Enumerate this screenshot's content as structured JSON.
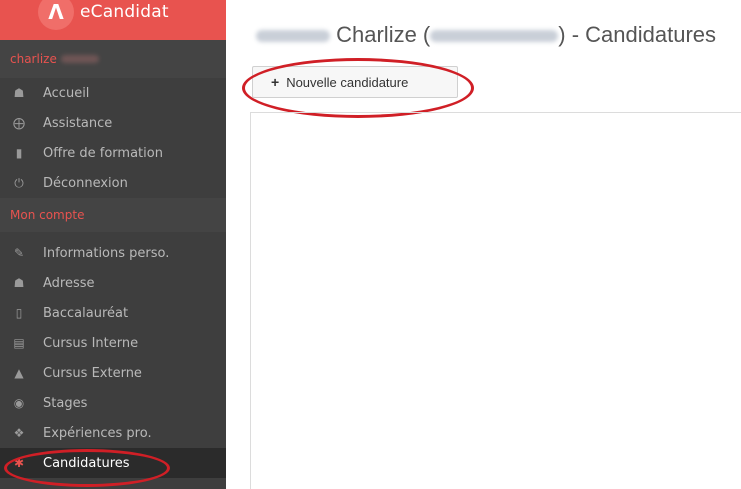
{
  "app": {
    "title": "eCandidat",
    "logo_glyph": "Λ"
  },
  "user": {
    "name_prefix": "charlize"
  },
  "sidebar": {
    "items": [
      {
        "label": "Accueil",
        "icon": "home-icon"
      },
      {
        "label": "Assistance",
        "icon": "lifebuoy-icon"
      },
      {
        "label": "Offre de formation",
        "icon": "bookmark-icon"
      },
      {
        "label": "Déconnexion",
        "icon": "power-icon"
      }
    ],
    "section_heading": "Mon compte",
    "account_items": [
      {
        "label": "Informations perso.",
        "icon": "pencil-icon"
      },
      {
        "label": "Adresse",
        "icon": "home-icon"
      },
      {
        "label": "Baccalauréat",
        "icon": "book-icon"
      },
      {
        "label": "Cursus Interne",
        "icon": "institution-icon"
      },
      {
        "label": "Cursus Externe",
        "icon": "graduation-cap-icon"
      },
      {
        "label": "Stages",
        "icon": "globe-icon"
      },
      {
        "label": "Expériences pro.",
        "icon": "cubes-icon"
      },
      {
        "label": "Candidatures",
        "icon": "asterisk-icon"
      }
    ]
  },
  "header": {
    "title_name": "Charlize (",
    "title_suffix": ") - Candidatures"
  },
  "toolbar": {
    "new_label": "Nouvelle candidature",
    "new_icon": "+"
  },
  "colors": {
    "accent": "#e8534f",
    "sidebar_bg": "#3e3e3e",
    "annotation": "#d01f26"
  }
}
